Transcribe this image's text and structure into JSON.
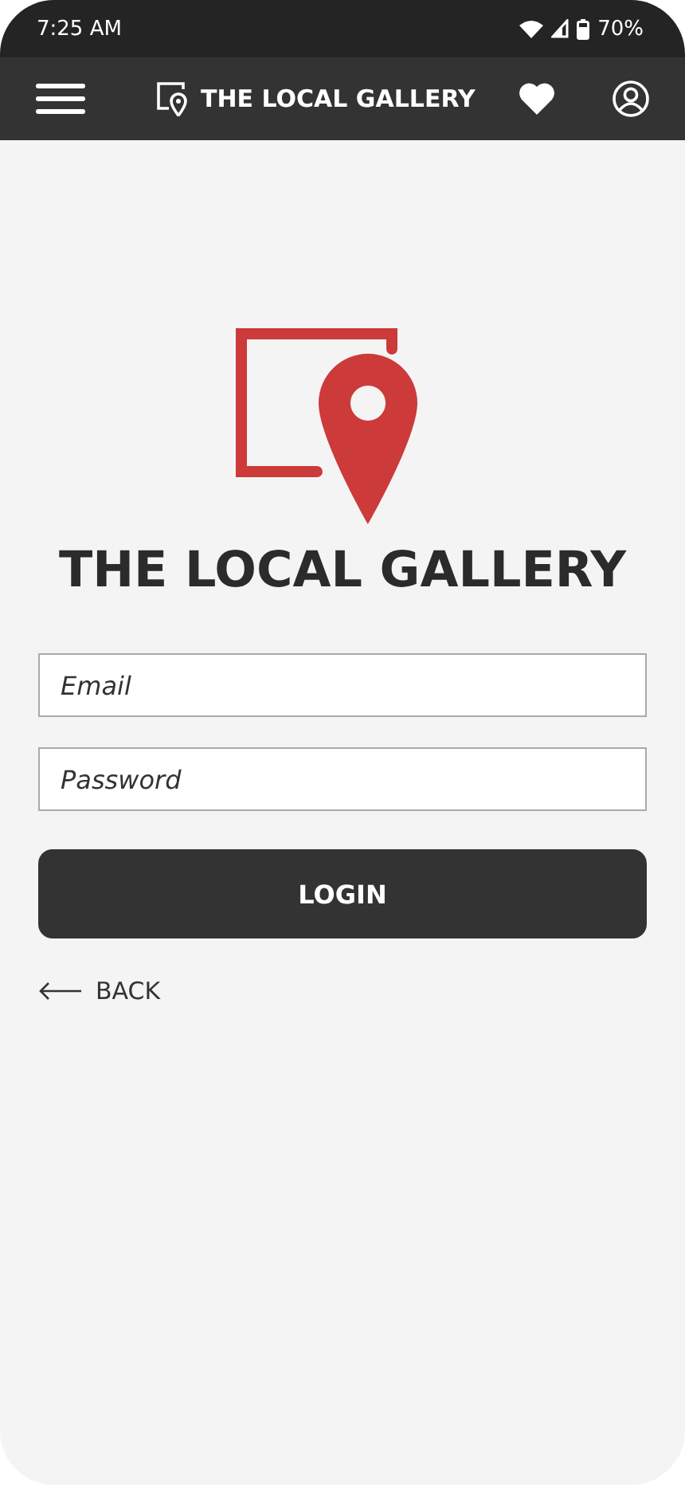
{
  "status_bar": {
    "time": "7:25 AM",
    "battery": "70%"
  },
  "header": {
    "title": "THE LOCAL GALLERY"
  },
  "brand": {
    "name": "THE LOCAL GALLERY"
  },
  "form": {
    "fields": [
      {
        "placeholder": "Email"
      },
      {
        "placeholder": "Password"
      }
    ],
    "submit": "LOGIN",
    "back": "BACK"
  }
}
